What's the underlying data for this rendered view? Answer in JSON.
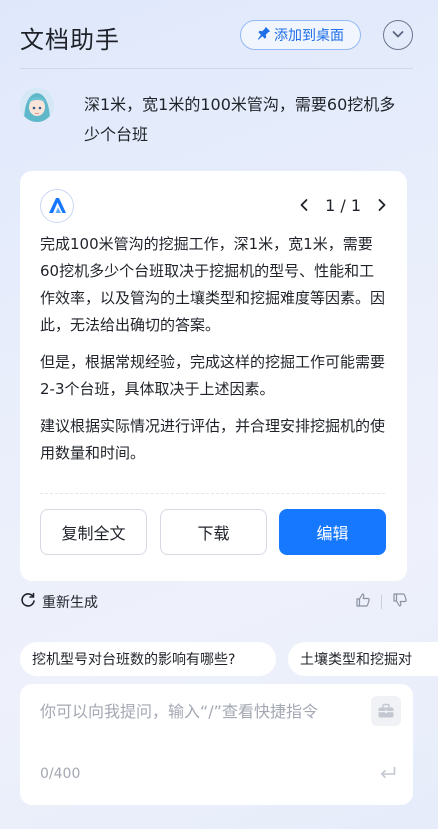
{
  "header": {
    "title": "文档助手",
    "pin_label": "添加到桌面",
    "pin_icon": "pin-icon",
    "collapse_icon": "chevron-down-icon"
  },
  "conversation": {
    "user_question": "深1米，宽1米的100米管沟，需要60挖机多少个台班",
    "answer": {
      "pager": "1 / 1",
      "paragraphs": [
        "完成100米管沟的挖掘工作，深1米，宽1米，需要60挖机多少个台班取决于挖掘机的型号、性能和工作效率，以及管沟的土壤类型和挖掘难度等因素。因此，无法给出确切的答案。",
        "但是，根据常规经验，完成这样的挖掘工作可能需要2-3个台班，具体取决于上述因素。",
        "建议根据实际情况进行评估，并合理安排挖掘机的使用数量和时间。"
      ],
      "copy_label": "复制全文",
      "download_label": "下载",
      "edit_label": "编辑"
    },
    "regenerate_label": "重新生成"
  },
  "suggestions": [
    "挖机型号对台班数的影响有哪些?",
    "土壤类型和挖掘对"
  ],
  "input": {
    "placeholder": "你可以向我提问，输入“/”查看快捷指令",
    "counter": "0/400"
  },
  "colors": {
    "accent": "#1677ff",
    "pin_text": "#1f6fe8"
  }
}
